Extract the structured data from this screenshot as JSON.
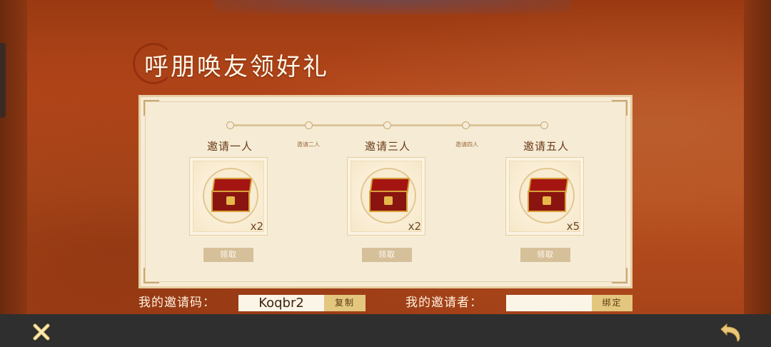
{
  "title": "呼朋唤友领好礼",
  "milestones": [
    {
      "label": "邀请一人",
      "reward_icon": "treasure-chest-icon",
      "quantity": "x2",
      "claim_label": "领取"
    },
    {
      "label": "邀请三人",
      "reward_icon": "treasure-chest-icon",
      "quantity": "x2",
      "claim_label": "领取"
    },
    {
      "label": "邀请五人",
      "reward_icon": "treasure-chest-icon",
      "quantity": "x5",
      "claim_label": "领取"
    }
  ],
  "intermediate_labels": [
    "邀请二人",
    "邀请四人"
  ],
  "invite_code": {
    "label": "我的邀请码：",
    "value": "Koqbr2",
    "copy_label": "复制"
  },
  "inviter": {
    "label": "我的邀请者：",
    "value": "",
    "bind_label": "绑定"
  },
  "bottom_bar": {
    "close_icon": "close-x-icon",
    "back_icon": "back-arrow-icon"
  },
  "colors": {
    "background": "#b5461a",
    "panel": "#f6ecd6",
    "button_gold": "#e3c77f",
    "claim_disabled": "#d6c09a"
  }
}
